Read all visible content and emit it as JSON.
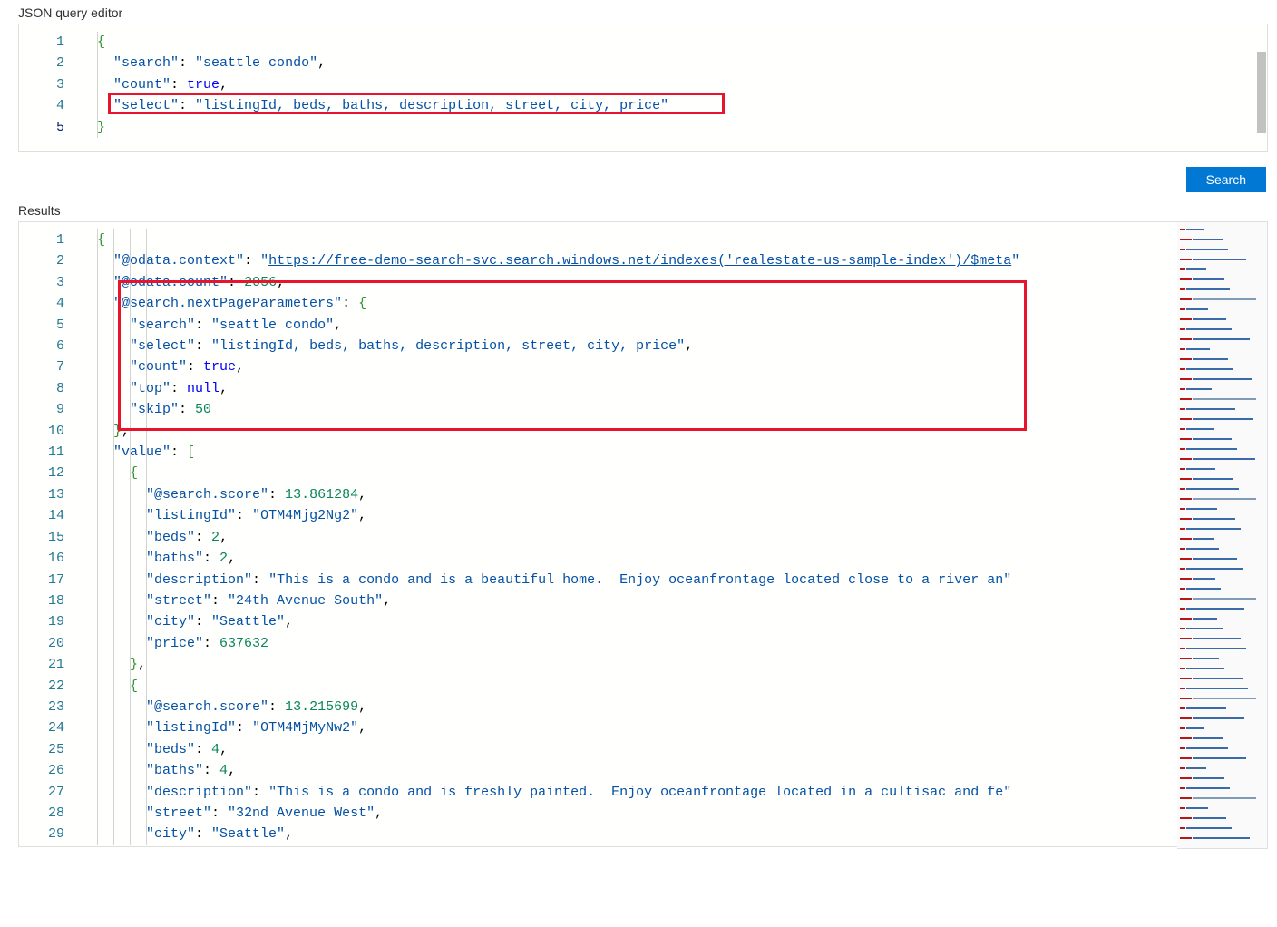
{
  "labels": {
    "editor": "JSON query editor",
    "results": "Results",
    "search_btn": "Search"
  },
  "query": {
    "search": "seattle condo",
    "count": true,
    "select": "listingId, beds, baths, description, street, city, price"
  },
  "results": {
    "@odata.context": "https://free-demo-search-svc.search.windows.net/indexes('realestate-us-sample-index')/$meta",
    "@odata.count": 2056,
    "@search.nextPageParameters": {
      "search": "seattle condo",
      "select": "listingId, beds, baths, description, street, city, price",
      "count": true,
      "top": null,
      "skip": 50
    },
    "value": [
      {
        "@search.score": 13.861284,
        "listingId": "OTM4Mjg2Ng2",
        "beds": 2,
        "baths": 2,
        "description": "This is a condo and is a beautiful home.  Enjoy oceanfrontage located close to a river an",
        "street": "24th Avenue South",
        "city": "Seattle",
        "price": 637632
      },
      {
        "@search.score": 13.215699,
        "listingId": "OTM4MjMyNw2",
        "beds": 4,
        "baths": 4,
        "description": "This is a condo and is freshly painted.  Enjoy oceanfrontage located in a cultisac and fe",
        "street": "32nd Avenue West",
        "city": "Seattle"
      }
    ]
  }
}
